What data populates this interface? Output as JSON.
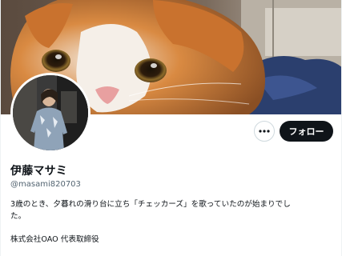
{
  "profile": {
    "display_name": "伊藤マサミ",
    "handle": "@masami820703",
    "bio_line1": "3歳のとき、夕暮れの滑り台に立ち「チェッカーズ」を歌っていたのが始まりでし",
    "bio_line2": "た。",
    "company": "株式会社OAO 代表取締役"
  },
  "actions": {
    "more_icon": "more-horizontal-icon",
    "follow_label": "フォロー"
  },
  "colors": {
    "primary_text": "#0f1419",
    "secondary_text": "#536471",
    "follow_button_bg": "#0f1419",
    "border": "#cfd9de"
  }
}
